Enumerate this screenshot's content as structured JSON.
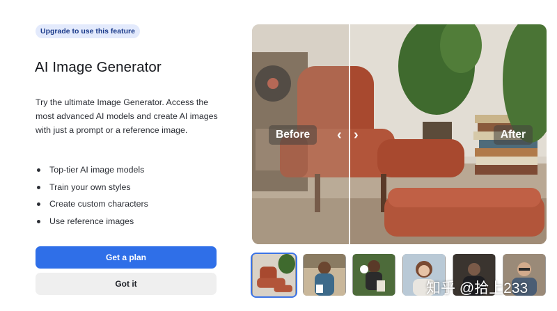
{
  "badge": "Upgrade to use this feature",
  "title": "AI Image Generator",
  "description": "Try the ultimate Image Generator. Access the most advanced AI models and create AI images with just a prompt or a reference image.",
  "features": [
    "Top-tier AI image models",
    "Train your own styles",
    "Create custom characters",
    "Use reference images"
  ],
  "buttons": {
    "primary": "Get a plan",
    "secondary": "Got it"
  },
  "preview": {
    "before_label": "Before",
    "after_label": "After",
    "left_arrow": "‹",
    "right_arrow": "›"
  },
  "thumbnails": [
    {
      "subject": "chair",
      "selected": true
    },
    {
      "subject": "person",
      "selected": false
    },
    {
      "subject": "soccer",
      "selected": false
    },
    {
      "subject": "woman",
      "selected": false
    },
    {
      "subject": "man-dark",
      "selected": false
    },
    {
      "subject": "man-glasses",
      "selected": false
    }
  ],
  "watermark": "知乎 @拾上233",
  "colors": {
    "primary": "#2f6fe8",
    "badge_bg": "#e3eafc",
    "selected_border": "#3b73e6",
    "chair": "#b2553a"
  }
}
